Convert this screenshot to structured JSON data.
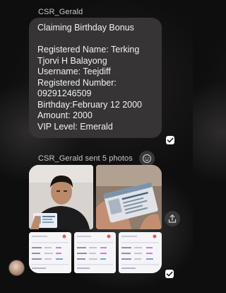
{
  "messages": [
    {
      "sender": "CSR_Gerald",
      "lines": [
        "Claiming Birthday Bonus",
        "",
        "Registered Name: Terking",
        "Tjorvi H Balayong",
        "Username: Teejdiff",
        "Registered Number:",
        "09291246509",
        "Birthday:February 12 2000",
        "Amount: 2000",
        "VIP Level: Emerald"
      ]
    },
    {
      "sender_line": "CSR_Gerald sent 5 photos",
      "photo_count": 5
    }
  ],
  "icons": {
    "seen": "check-icon",
    "react": "face-icon",
    "share": "share-icon",
    "avatar": "avatar"
  },
  "colors": {
    "bubble": "#363434",
    "background": "#0f0e0e",
    "meta_text": "#c9c9c9"
  }
}
